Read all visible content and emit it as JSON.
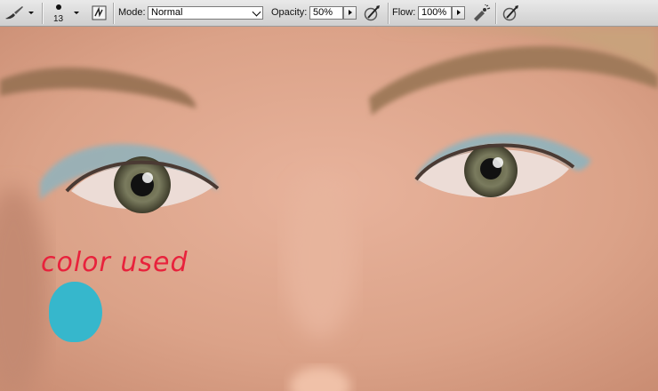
{
  "toolbar": {
    "brush_size": "13",
    "mode_label": "Mode:",
    "mode_value": "Normal",
    "opacity_label": "Opacity:",
    "opacity_value": "50%",
    "flow_label": "Flow:",
    "flow_value": "100%"
  },
  "canvas": {
    "annotation_text": "color used",
    "swatch_color": "#36b7cc",
    "annotation_color": "#e8223c",
    "skin_color": "#d9a48c"
  }
}
